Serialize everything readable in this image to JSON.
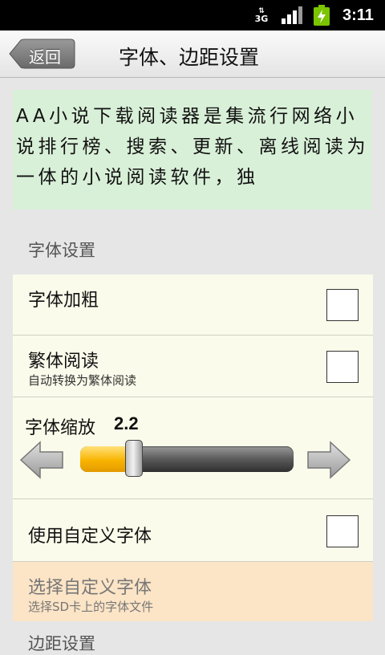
{
  "status_bar": {
    "network": "3G",
    "time": "3:11",
    "signal_icon": "signal-bars-icon",
    "battery_icon": "battery-charging-icon",
    "battery_color": "#7bc400"
  },
  "header": {
    "back_label": "返回",
    "title": "字体、边距设置"
  },
  "preview": {
    "text": "AA小说下载阅读器是集流行网络小说排行榜、搜索、更新、离线阅读为一体的小说阅读软件，独"
  },
  "font_settings": {
    "header": "字体设置",
    "bold": {
      "title": "字体加粗",
      "checked": false
    },
    "traditional": {
      "title": "繁体阅读",
      "subtitle": "自动转换为繁体阅读",
      "checked": false
    },
    "scale": {
      "label": "字体缩放",
      "value": "2.2",
      "fraction": 0.25
    },
    "custom_font": {
      "title": "使用自定义字体",
      "checked": false
    },
    "choose_font": {
      "title": "选择自定义字体",
      "subtitle": "选择SD卡上的字体文件"
    }
  },
  "colors": {
    "preview_bg": "#d9f0d8",
    "row_bg": "#fafbea",
    "disabled_row_bg": "#fce4c6",
    "slider_fill": "#f8b400"
  },
  "next_section": {
    "header": "边距设置"
  }
}
